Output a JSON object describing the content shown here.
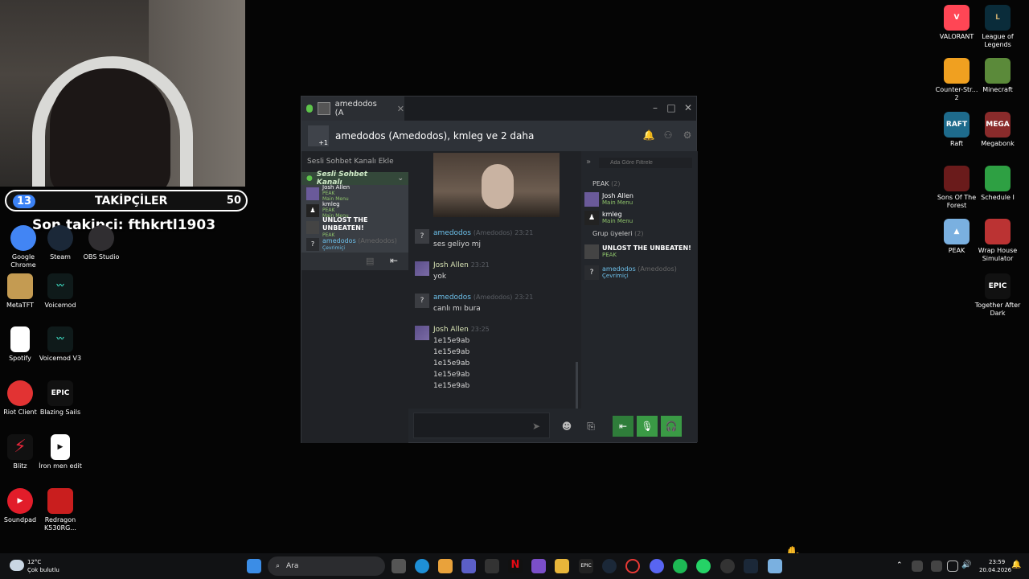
{
  "overlay": {
    "followers_label": "TAKİPÇİLER",
    "followers_current": "13",
    "followers_goal": "50",
    "last_follower": "Son takipçi: fthkrtl1903"
  },
  "desktop_icons": [
    {
      "label": "Google Chrome",
      "color": "#4285f4"
    },
    {
      "label": "Steam",
      "color": "#1b2838"
    },
    {
      "label": "OBS Studio",
      "color": "#302e31"
    },
    {
      "label": "MetaTFT",
      "color": "#c49b52"
    },
    {
      "label": "Voicemod",
      "color": "#0f1a1a"
    },
    {
      "label": "Spotify",
      "color": "#ffffff"
    },
    {
      "label": "Voicemod V3",
      "color": "#0f1a1a"
    },
    {
      "label": "Riot Client",
      "color": "#e23333"
    },
    {
      "label": "Blazing Sails",
      "color": "#111111"
    },
    {
      "label": "Blitz",
      "color": "#e0263a"
    },
    {
      "label": "İron men edit",
      "color": "#ffffff"
    },
    {
      "label": "Soundpad",
      "color": "#e21d2a"
    },
    {
      "label": "Redragon K530RG...",
      "color": "#c91e1e"
    },
    {
      "label": "VALORANT",
      "color": "#ff4655"
    },
    {
      "label": "League of Legends",
      "color": "#0a2c3a"
    },
    {
      "label": "Counter-Str... 2",
      "color": "#f0a020"
    },
    {
      "label": "Minecraft",
      "color": "#5b8a3a"
    },
    {
      "label": "Raft",
      "color": "#1e6b8c"
    },
    {
      "label": "Megabonk",
      "color": "#8a2b2b"
    },
    {
      "label": "Sons Of The Forest",
      "color": "#6a1b1b"
    },
    {
      "label": "Schedule I",
      "color": "#2ea043"
    },
    {
      "label": "PEAK",
      "color": "#7ab0e0"
    },
    {
      "label": "Wrap House Simulator",
      "color": "#b33"
    },
    {
      "label": "Together After Dark",
      "color": "#111111"
    }
  ],
  "steam": {
    "tab_title": "amedodos (A",
    "header_title": "amedodos (Amedodos), kmleg ve 2 daha",
    "header_badge": "+1",
    "add_voice_channel": "Sesli Sohbet Kanalı Ekle",
    "voice_channel_name": "Sesli Sohbet Kanalı",
    "voice_members": [
      {
        "name": "Josh Allen",
        "sub": "PEAK",
        "sub2": "Main Menu"
      },
      {
        "name": "kmleg",
        "sub": "PEAK",
        "sub2": "Main Menu"
      },
      {
        "name": "UNLOST THE UNBEATEN!",
        "sub": "PEAK",
        "sub2": ""
      },
      {
        "name": "amedodos",
        "sub": "Çevrimiçi",
        "extra": "(Amedodos)"
      }
    ],
    "messages": [
      {
        "name": "amedodos",
        "extra": "(Amedodos)",
        "time": "23:21",
        "lines": [
          "ses geliyo mj"
        ]
      },
      {
        "name": "Josh Allen",
        "extra": "",
        "time": "23:21",
        "lines": [
          "yok"
        ]
      },
      {
        "name": "amedodos",
        "extra": "(Amedodos)",
        "time": "23:21",
        "lines": [
          "canlı mı bura"
        ]
      },
      {
        "name": "Josh Allen",
        "extra": "",
        "time": "23:25",
        "lines": [
          "1e15e9ab",
          "1e15e9ab",
          "1e15e9ab",
          "1e15e9ab",
          "1e15e9ab"
        ]
      }
    ],
    "filter_placeholder": "Ada Göre Filtrele",
    "right_groups": [
      {
        "title": "PEAK",
        "count": "(2)"
      },
      {
        "title": "Grup üyeleri",
        "count": "(2)"
      }
    ],
    "right_members": [
      {
        "name": "Josh Allen",
        "sub": "Main Menu"
      },
      {
        "name": "kmleg",
        "sub": "Main Menu"
      },
      {
        "name": "UNLOST THE UNBEATEN!",
        "sub": "PEAK"
      },
      {
        "name": "amedodos",
        "extra": "(Amedodos)",
        "sub": "Çevrimiçi"
      }
    ]
  },
  "taskbar": {
    "weather_temp": "12°C",
    "weather_desc": "Çok bulutlu",
    "search_label": "Ara",
    "time": "23:59",
    "date": "20.04.2026"
  }
}
